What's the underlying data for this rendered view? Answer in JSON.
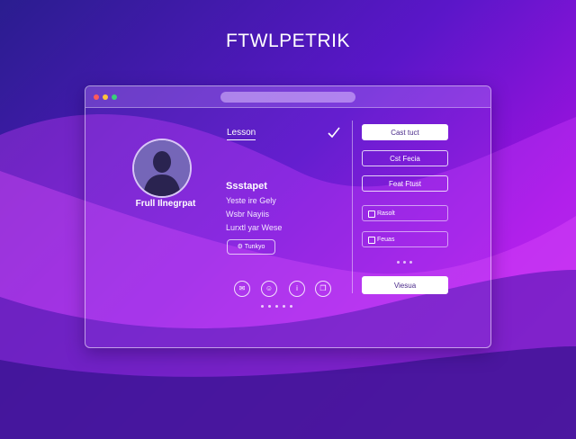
{
  "page": {
    "title": "FTWLPETRIK"
  },
  "window": {
    "controls": [
      "close",
      "minimize",
      "maximize"
    ]
  },
  "profile": {
    "name": "Frull Ilnegrpat",
    "avatar_icon": "person-silhouette-icon"
  },
  "lesson": {
    "title": "Lesson",
    "check_icon": "checkmark-icon",
    "section_title": "Ssstapet",
    "details": [
      "Yeste ire Gely",
      "Wsbr Nayiis",
      "Lurxtl yar Wese"
    ],
    "chip_label": "Tunkyo"
  },
  "actions": {
    "icons": [
      "chat-icon",
      "badge-icon",
      "info-icon",
      "copy-icon"
    ]
  },
  "sidebar": {
    "primary_button": "Cast tuct",
    "button2": "Cst Fecia",
    "button3": "Feat Ftust",
    "item1": "Rasolt",
    "item2": "Feuas",
    "bottom_button": "Viesua"
  },
  "colors": {
    "bg_start": "#2a1d8f",
    "bg_end": "#b61ee8",
    "close_dot": "#ff5a5a",
    "minimize_dot": "#ffc43a",
    "maximize_dot": "#3ad07a"
  }
}
